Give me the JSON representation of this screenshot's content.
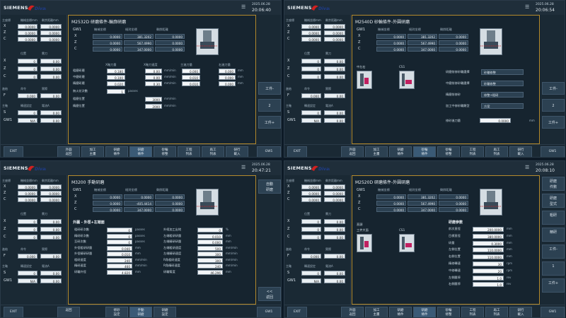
{
  "brand": {
    "name": "SIEMENS",
    "logo_text": "Divan"
  },
  "common": {
    "date": "2025.06.28",
    "left_panel": {
      "section1_label": "主座標",
      "col1": "機械坐標mm",
      "col2": "剩余距離mm",
      "axes": [
        {
          "name": "X",
          "a": "0.0000",
          "b": "0.0000"
        },
        {
          "name": "Z",
          "a": "0.0000",
          "b": "0.0000"
        },
        {
          "name": "C",
          "a": "0.0000",
          "b": "0.0000"
        }
      ],
      "section2_labels": [
        "位置",
        "需刀"
      ],
      "axes2": [
        {
          "name": "X",
          "a": "0",
          "b": "0.00"
        },
        {
          "name": "Z",
          "a": "0",
          "b": "0.00"
        },
        {
          "name": "C",
          "a": "0",
          "b": "0.00"
        }
      ],
      "feed_label": "進給",
      "feed_sub": [
        "命令",
        "實際"
      ],
      "f_label": "F",
      "f_val": "0.000",
      "f_val2": "0.00",
      "spindle_label": "主軸",
      "spindle_sub": [
        "轉速設定",
        "電流A"
      ],
      "s_label": "S",
      "s_val": "0",
      "s_val2": "0.00",
      "gw": "GW1",
      "gw_val": "N/A",
      "gw_val2": "0.00"
    },
    "right_buttons": [
      "工件-",
      "2",
      "工件+"
    ],
    "exit": "EXIT",
    "gw1_btn": "GW1"
  },
  "screens": [
    {
      "time": "20:06:40",
      "title": "M2532D 研磨條件-輪廓研磨",
      "coord_headers": [
        "機械坐標",
        "絕對坐標",
        "剩餘距離"
      ],
      "gw": "GW1",
      "coords": [
        {
          "ax": "X",
          "a": "0.0000",
          "b": "381.3202",
          "c": "0.0000"
        },
        {
          "ax": "Z",
          "a": "0.0000",
          "b": "567.4990",
          "c": "0.0000"
        },
        {
          "ax": "C",
          "a": "0.0000",
          "b": "347.0000",
          "c": "0.0000"
        }
      ],
      "param_headers": [
        "X軸刀量",
        "X軸刀速度",
        "主進刀量",
        "右進刀量"
      ],
      "params": [
        {
          "label": "粗磨研磨",
          "v1": "0.180",
          "v2": "0.00",
          "u2": "mm/min",
          "v3": "0.000",
          "v4": "0.000",
          "u4": "mm"
        },
        {
          "label": "中磨研磨",
          "v1": "0.100",
          "v2": "0.00",
          "u2": "mm/min",
          "v3": "0.010",
          "v4": "0.000",
          "u4": "mm"
        },
        {
          "label": "精磨研磨",
          "v1": "0.020",
          "v2": "0.30",
          "u2": "mm/min",
          "v3": "0.010",
          "v4": "0.000",
          "u4": "mm"
        }
      ],
      "passes_label": "無火花次數",
      "passes_val": "1",
      "passes_unit": "passes",
      "rough_pos_label": "粗磨位置",
      "rough_pos_val": "3000",
      "fine_pos_label": "精磨位置",
      "fine_pos_val": "2000",
      "pos_unit": "mm/min",
      "bottom": [
        "外圓\n返回",
        "加工\n主畫",
        "研磨\n條件",
        "研磨\n條件",
        "砂輪\n修整",
        "工程\n列表",
        "再工\n列表",
        "研行\n載入"
      ]
    },
    {
      "time": "20:06:54",
      "title": "M2540D 砂輪條件-外圓研磨",
      "coord_headers": [
        "機械坐標",
        "絕對坐標",
        "剩餘距離"
      ],
      "gw": "GW1",
      "coords": [
        {
          "ax": "X",
          "a": "0.0000",
          "b": "381.3202",
          "c": "0.0000"
        },
        {
          "ax": "Z",
          "a": "0.0000",
          "b": "567.4990",
          "c": "0.0000"
        },
        {
          "ax": "C",
          "a": "0.0000",
          "b": "347.0000",
          "c": "0.0000"
        }
      ],
      "left_img_label": "中左右",
      "right_img_label": "CS1",
      "dd_rows": [
        {
          "label": "研磨前修砂輪選擇",
          "val": "砂輪修整"
        },
        {
          "label": "中磨前修砂輪選擇",
          "val": "砂輪修整"
        },
        {
          "label": "精磨前修砂",
          "val": "修整+粗研"
        },
        {
          "label": "加工中修砂輪類型",
          "val": "方案"
        }
      ],
      "dress_label": "修砂進刀量",
      "dress_val": "0.0000",
      "dress_unit": "mm",
      "bottom": [
        "外圓\n返回",
        "加工\n主畫",
        "研磨\n條件",
        "砂輪\n條件",
        "砂輪\n修整",
        "工程\n列表",
        "再工\n列表",
        "研行\n載入"
      ]
    },
    {
      "time": "20:47:21",
      "title": "M3200 手動研磨",
      "coord_headers": [
        "機械坐標",
        "絕對坐標",
        "剩餘距離"
      ],
      "gw": "GW1",
      "coords": [
        {
          "ax": "X",
          "a": "0.0000",
          "b": "0.0000",
          "c": "0.0000"
        },
        {
          "ax": "Z",
          "a": "0.0000",
          "b": "-405.4414",
          "c": "0.0000"
        },
        {
          "ax": "C",
          "a": "0.0000",
          "b": "347.0000",
          "c": "0.0000"
        }
      ],
      "sect": "外圓 - 外徑+左端面",
      "colA": [
        {
          "l": "粗研研次數",
          "v": "0",
          "u": "passes"
        },
        {
          "l": "精研研次數",
          "v": "0",
          "u": "passes"
        },
        {
          "l": "至研次數",
          "v": "0",
          "u": "passes"
        },
        {
          "l": "外徑粗研研量",
          "v": "0.040",
          "u": "mm"
        },
        {
          "l": "外徑精研研量",
          "v": "0.010",
          "u": "mm"
        },
        {
          "l": "粗研速度",
          "v": "240",
          "u": "mm/min"
        },
        {
          "l": "精研速度",
          "v": "460",
          "u": "mm/min"
        },
        {
          "l": "研輪外徑",
          "v": "4.820",
          "u": "mm"
        }
      ],
      "colB": [
        {
          "l": "外經加工出地",
          "v": "0",
          "u": "%"
        },
        {
          "l": "左端粗研研量",
          "v": "0.010",
          "u": "mm"
        },
        {
          "l": "左端精研研量",
          "v": "0.000",
          "u": "mm"
        },
        {
          "l": "左端粗研速度",
          "v": "500",
          "u": "mm/min"
        },
        {
          "l": "左端精研速度",
          "v": "300",
          "u": "mm/min"
        },
        {
          "l": "R角粗研速度",
          "v": "300",
          "u": "mm/min"
        },
        {
          "l": "R角精研速度",
          "v": "240",
          "u": "mm/min"
        },
        {
          "l": "研輪幫度",
          "v": "46.296",
          "u": "mm"
        }
      ],
      "right_top": "自動\n研磨",
      "right_bot": "<<\n返回",
      "bottom": [
        "返回",
        "",
        "修砂\n設定",
        "手動\n研磨",
        "研磨\n設定"
      ]
    },
    {
      "time": "20:08:10",
      "title": "M2520D 研磨條件-外圓研磨",
      "coord_headers": [
        "機械坐標",
        "絕對坐標",
        "剩餘距離"
      ],
      "gw": "GW1",
      "coords": [
        {
          "ax": "X",
          "a": "0.0000",
          "b": "381.3202",
          "c": "0.0000"
        },
        {
          "ax": "Z",
          "a": "0.0000",
          "b": "567.4990",
          "c": "0.0000"
        },
        {
          "ax": "C",
          "a": "0.0000",
          "b": "347.0000",
          "c": "0.0000"
        }
      ],
      "img_label": "直頭",
      "img_sub": "工件大面",
      "right_img_label": "CS1",
      "param_sect": "研磨參數",
      "params": [
        {
          "l": "前次直徑",
          "v": "200.0000",
          "u": "mm"
        },
        {
          "l": "目標直徑",
          "v": "380.0000",
          "u": "mm"
        },
        {
          "l": "研量",
          "v": "0.3000",
          "u": "mm"
        },
        {
          "l": "左側位置",
          "v": "110.0000",
          "u": "mm"
        },
        {
          "l": "右側位置",
          "v": "110.0000",
          "u": "mm"
        },
        {
          "l": "精修轉速",
          "v": "30",
          "u": "rpm"
        },
        {
          "l": "中修轉速",
          "v": "20",
          "u": "rpm"
        },
        {
          "l": "左側壓停",
          "v": "1.0",
          "u": "rev"
        },
        {
          "l": "右側壓停",
          "v": "1.0",
          "u": "rev"
        }
      ],
      "right_btns": [
        "研磨\n件數",
        "研磨\n型式",
        "粗研",
        "精研",
        "工件-",
        "1",
        "工件+"
      ],
      "bottom": [
        "外圓\n返回",
        "加工\n主畫",
        "研磨\n條件",
        "研磨\n條件",
        "砂輪\n修整",
        "工程\n列表",
        "再工\n列表",
        "研行\n載入"
      ]
    }
  ]
}
